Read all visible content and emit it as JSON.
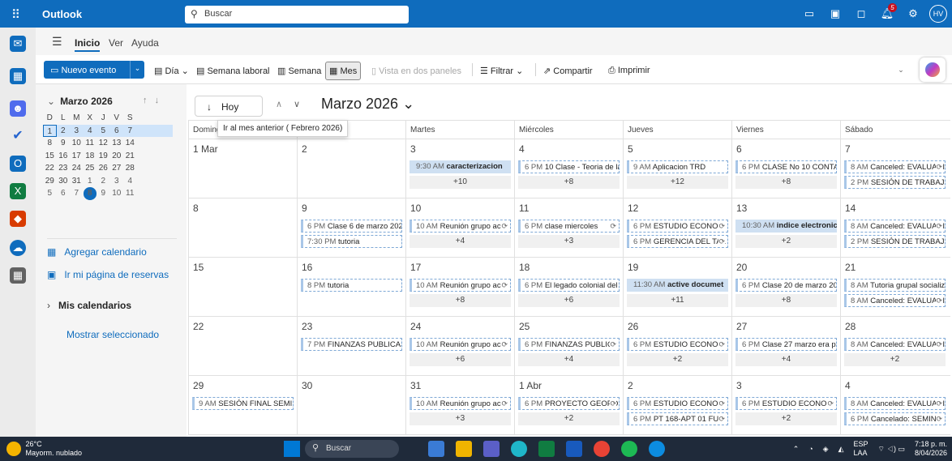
{
  "app": {
    "name": "Outlook",
    "search_placeholder": "Buscar",
    "avatar": "HV"
  },
  "ribbon": {
    "tabs": [
      "Inicio",
      "Ver",
      "Ayuda"
    ],
    "new_event": "Nuevo evento",
    "views": {
      "day": "Día",
      "work_week": "Semana laboral",
      "week": "Semana",
      "month": "Mes",
      "split": "Vista en dos paneles"
    },
    "filter": "Filtrar",
    "share": "Compartir",
    "print": "Imprimir"
  },
  "mini_calendar": {
    "title": "Marzo 2026",
    "weekdays": [
      "D",
      "L",
      "M",
      "X",
      "J",
      "V",
      "S"
    ],
    "weeks": [
      [
        "1",
        "2",
        "3",
        "4",
        "5",
        "6",
        "7"
      ],
      [
        "8",
        "9",
        "10",
        "11",
        "12",
        "13",
        "14"
      ],
      [
        "15",
        "16",
        "17",
        "18",
        "19",
        "20",
        "21"
      ],
      [
        "22",
        "23",
        "24",
        "25",
        "26",
        "27",
        "28"
      ],
      [
        "29",
        "30",
        "31",
        "1",
        "2",
        "3",
        "4"
      ],
      [
        "5",
        "6",
        "7",
        "8",
        "9",
        "10",
        "11"
      ]
    ]
  },
  "left_panel": {
    "add_calendar": "Agregar calendario",
    "booking_page": "Ir mi página de reservas",
    "my_calendars": "Mis calendarios",
    "show_selected": "Mostrar seleccionado"
  },
  "calendar": {
    "today": "Hoy",
    "month_title": "Marzo 2026",
    "tooltip": "Ir al mes anterior ( Febrero 2026)",
    "dow": [
      "Doming",
      "Lunes",
      "Martes",
      "Miércoles",
      "Jueves",
      "Viernes",
      "Sábado"
    ],
    "weeks": [
      [
        {
          "d": "1 Mar",
          "ev": []
        },
        {
          "d": "2",
          "ev": []
        },
        {
          "d": "3",
          "ev": [
            {
              "t": "9:30 AM",
              "n": "caracterizacion",
              "s": true
            }
          ],
          "more": "+10"
        },
        {
          "d": "4",
          "ev": [
            {
              "t": "6 PM",
              "n": "10 Clase - Teoria de las"
            }
          ],
          "more": "+8"
        },
        {
          "d": "5",
          "ev": [
            {
              "t": "9 AM",
              "n": "Aplicacion TRD"
            }
          ],
          "more": "+12"
        },
        {
          "d": "6",
          "ev": [
            {
              "t": "6 PM",
              "n": "CLASE No 10 CONTAB"
            }
          ],
          "more": "+8"
        },
        {
          "d": "7",
          "ev": [
            {
              "t": "8 AM",
              "n": "Canceled: EVALUACI",
              "r": true
            },
            {
              "t": "2 PM",
              "n": "SESIÓN DE TRABAJO :"
            }
          ]
        }
      ],
      [
        {
          "d": "8",
          "ev": []
        },
        {
          "d": "9",
          "ev": [
            {
              "t": "6 PM",
              "n": "Clase 6 de marzo 2026"
            },
            {
              "t": "7:30 PM",
              "n": "tutoria"
            }
          ]
        },
        {
          "d": "10",
          "ev": [
            {
              "t": "10 AM",
              "n": "Reunión grupo ac",
              "r": true
            }
          ],
          "more": "+4"
        },
        {
          "d": "11",
          "ev": [
            {
              "t": "6 PM",
              "n": "clase miercoles",
              "r": true
            }
          ],
          "more": "+3"
        },
        {
          "d": "12",
          "ev": [
            {
              "t": "6 PM",
              "n": "ESTUDIO ECONOM",
              "r": true
            },
            {
              "t": "6 PM",
              "n": "GERENCIA DEL TAL",
              "r": true
            }
          ]
        },
        {
          "d": "13",
          "ev": [
            {
              "t": "10:30 AM",
              "n": "indice electronico",
              "s": true
            }
          ],
          "more": "+2"
        },
        {
          "d": "14",
          "ev": [
            {
              "t": "8 AM",
              "n": "Canceled: EVALUACI",
              "r": true
            },
            {
              "t": "2 PM",
              "n": "SESIÓN DE TRABAJO :"
            }
          ]
        }
      ],
      [
        {
          "d": "15",
          "ev": []
        },
        {
          "d": "16",
          "ev": [
            {
              "t": "8 PM",
              "n": "tutoria"
            }
          ]
        },
        {
          "d": "17",
          "ev": [
            {
              "t": "10 AM",
              "n": "Reunión grupo ac",
              "r": true
            }
          ],
          "more": "+8"
        },
        {
          "d": "18",
          "ev": [
            {
              "t": "6 PM",
              "n": "El legado colonial del"
            }
          ],
          "more": "+6"
        },
        {
          "d": "19",
          "ev": [
            {
              "t": "11:30 AM",
              "n": "active documet",
              "s": true
            }
          ],
          "more": "+11"
        },
        {
          "d": "20",
          "ev": [
            {
              "t": "6 PM",
              "n": "Clase 20 de marzo 202"
            }
          ],
          "more": "+8"
        },
        {
          "d": "21",
          "ev": [
            {
              "t": "8 AM",
              "n": "Tutoria grupal socializ"
            },
            {
              "t": "8 AM",
              "n": "Canceled: EVALUACI",
              "r": true
            }
          ]
        }
      ],
      [
        {
          "d": "22",
          "ev": []
        },
        {
          "d": "23",
          "ev": [
            {
              "t": "7 PM",
              "n": "FINANZAS PUBLICAS"
            }
          ]
        },
        {
          "d": "24",
          "ev": [
            {
              "t": "10 AM",
              "n": "Reunión grupo ac",
              "r": true
            }
          ],
          "more": "+6"
        },
        {
          "d": "25",
          "ev": [
            {
              "t": "6 PM",
              "n": "FINANZAS PUBLIC",
              "r": true
            }
          ],
          "more": "+4"
        },
        {
          "d": "26",
          "ev": [
            {
              "t": "6 PM",
              "n": "ESTUDIO ECONOM",
              "r": true
            }
          ],
          "more": "+2"
        },
        {
          "d": "27",
          "ev": [
            {
              "t": "6 PM",
              "n": "Clase 27 marzo era pr"
            }
          ],
          "more": "+4"
        },
        {
          "d": "28",
          "ev": [
            {
              "t": "8 AM",
              "n": "Canceled: EVALUACI",
              "r": true
            }
          ],
          "more": "+2"
        }
      ],
      [
        {
          "d": "29",
          "ev": [
            {
              "t": "9 AM",
              "n": "SESIÓN FINAL SEMIN."
            }
          ]
        },
        {
          "d": "30",
          "ev": []
        },
        {
          "d": "31",
          "ev": [
            {
              "t": "10 AM",
              "n": "Reunión grupo ac",
              "r": true
            }
          ],
          "more": "+3"
        },
        {
          "d": "1 Abr",
          "ev": [
            {
              "t": "6 PM",
              "n": "PROYECTO GEOPO",
              "r": true
            }
          ],
          "more": "+2"
        },
        {
          "d": "2",
          "ev": [
            {
              "t": "6 PM",
              "n": "ESTUDIO ECONOM",
              "r": true
            },
            {
              "t": "6 PM",
              "n": "PT 168-APT 01 FUN",
              "r": true
            }
          ]
        },
        {
          "d": "3",
          "ev": [
            {
              "t": "6 PM",
              "n": "ESTUDIO ECONOM",
              "r": true
            }
          ],
          "more": "+2"
        },
        {
          "d": "4",
          "ev": [
            {
              "t": "8 AM",
              "n": "Canceled: EVALUACI",
              "r": true
            },
            {
              "t": "6 PM",
              "n": "Cancelado: SEMINA",
              "r": true
            }
          ]
        }
      ]
    ]
  },
  "taskbar": {
    "temp": "26°C",
    "weather": "Mayorm. nublado",
    "search": "Buscar",
    "lang1": "ESP",
    "lang2": "LAA",
    "time": "7:18 p. m.",
    "date": "8/04/2026"
  },
  "colors": {
    "accent": "#0f6cbd",
    "taskbar": "#1f2a3a"
  }
}
